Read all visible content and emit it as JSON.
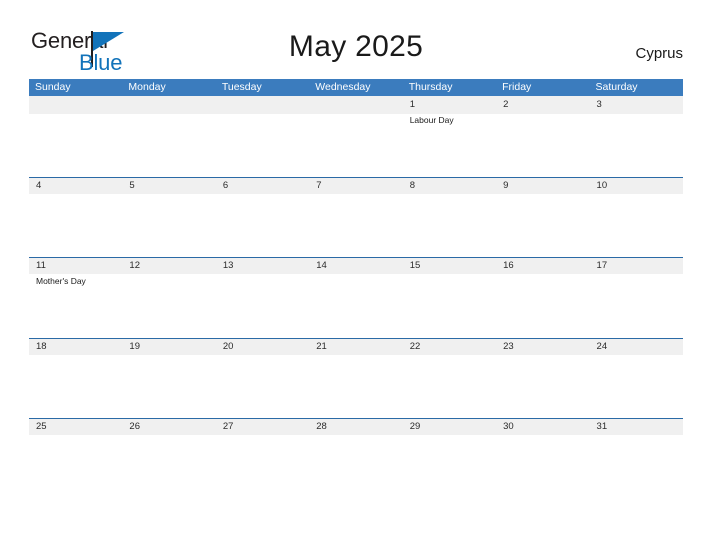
{
  "header": {
    "logo": {
      "primary_text": "General",
      "secondary_text": "Blue",
      "primary_color": "#231f20",
      "secondary_color": "#1273ba",
      "flag_icon": "blue-triangle-flag-icon"
    },
    "title": "May 2025",
    "country": "Cyprus"
  },
  "colors": {
    "weekday_header_bg": "#3b7cbe",
    "weekday_header_text": "#ffffff",
    "date_band_bg": "#f0f0f0",
    "week_separator": "#2a6aa6",
    "page_bg": "#ffffff",
    "date_text": "#2b2b2b",
    "event_text": "#1a1a1a"
  },
  "calendar": {
    "weekdays": [
      "Sunday",
      "Monday",
      "Tuesday",
      "Wednesday",
      "Thursday",
      "Friday",
      "Saturday"
    ],
    "weeks": [
      {
        "days": [
          {
            "date": "",
            "event": ""
          },
          {
            "date": "",
            "event": ""
          },
          {
            "date": "",
            "event": ""
          },
          {
            "date": "",
            "event": ""
          },
          {
            "date": "1",
            "event": "Labour Day"
          },
          {
            "date": "2",
            "event": ""
          },
          {
            "date": "3",
            "event": ""
          }
        ]
      },
      {
        "days": [
          {
            "date": "4",
            "event": ""
          },
          {
            "date": "5",
            "event": ""
          },
          {
            "date": "6",
            "event": ""
          },
          {
            "date": "7",
            "event": ""
          },
          {
            "date": "8",
            "event": ""
          },
          {
            "date": "9",
            "event": ""
          },
          {
            "date": "10",
            "event": ""
          }
        ]
      },
      {
        "days": [
          {
            "date": "11",
            "event": "Mother's Day"
          },
          {
            "date": "12",
            "event": ""
          },
          {
            "date": "13",
            "event": ""
          },
          {
            "date": "14",
            "event": ""
          },
          {
            "date": "15",
            "event": ""
          },
          {
            "date": "16",
            "event": ""
          },
          {
            "date": "17",
            "event": ""
          }
        ]
      },
      {
        "days": [
          {
            "date": "18",
            "event": ""
          },
          {
            "date": "19",
            "event": ""
          },
          {
            "date": "20",
            "event": ""
          },
          {
            "date": "21",
            "event": ""
          },
          {
            "date": "22",
            "event": ""
          },
          {
            "date": "23",
            "event": ""
          },
          {
            "date": "24",
            "event": ""
          }
        ]
      },
      {
        "days": [
          {
            "date": "25",
            "event": ""
          },
          {
            "date": "26",
            "event": ""
          },
          {
            "date": "27",
            "event": ""
          },
          {
            "date": "28",
            "event": ""
          },
          {
            "date": "29",
            "event": ""
          },
          {
            "date": "30",
            "event": ""
          },
          {
            "date": "31",
            "event": ""
          }
        ]
      }
    ]
  }
}
